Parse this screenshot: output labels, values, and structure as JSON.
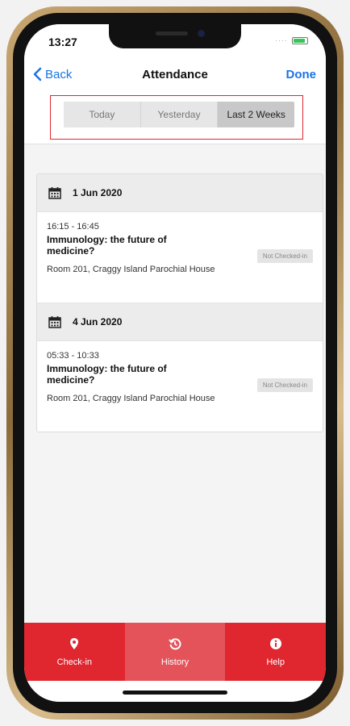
{
  "status": {
    "time": "13:27"
  },
  "nav": {
    "back_label": "Back",
    "title": "Attendance",
    "done_label": "Done"
  },
  "segments": [
    {
      "label": "Today",
      "active": false
    },
    {
      "label": "Yesterday",
      "active": false
    },
    {
      "label": "Last 2 Weeks",
      "active": true
    }
  ],
  "days": [
    {
      "date": "1 Jun 2020",
      "sessions": [
        {
          "time": "16:15 - 16:45",
          "title": "Immunology: the future of medicine?",
          "room": "Room 201, Craggy Island Parochial House",
          "status": "Not Checked-in"
        }
      ]
    },
    {
      "date": "4 Jun 2020",
      "sessions": [
        {
          "time": "05:33 - 10:33",
          "title": "Immunology: the future of medicine?",
          "room": "Room 201, Craggy Island Parochial House",
          "status": "Not Checked-in"
        }
      ]
    }
  ],
  "tabs": [
    {
      "label": "Check-in",
      "icon": "map-pin-icon",
      "active": false
    },
    {
      "label": "History",
      "icon": "history-icon",
      "active": true
    },
    {
      "label": "Help",
      "icon": "info-icon",
      "active": false
    }
  ],
  "colors": {
    "accent": "#e0262e",
    "link": "#1a73e8",
    "highlight_border": "#e0262e"
  }
}
